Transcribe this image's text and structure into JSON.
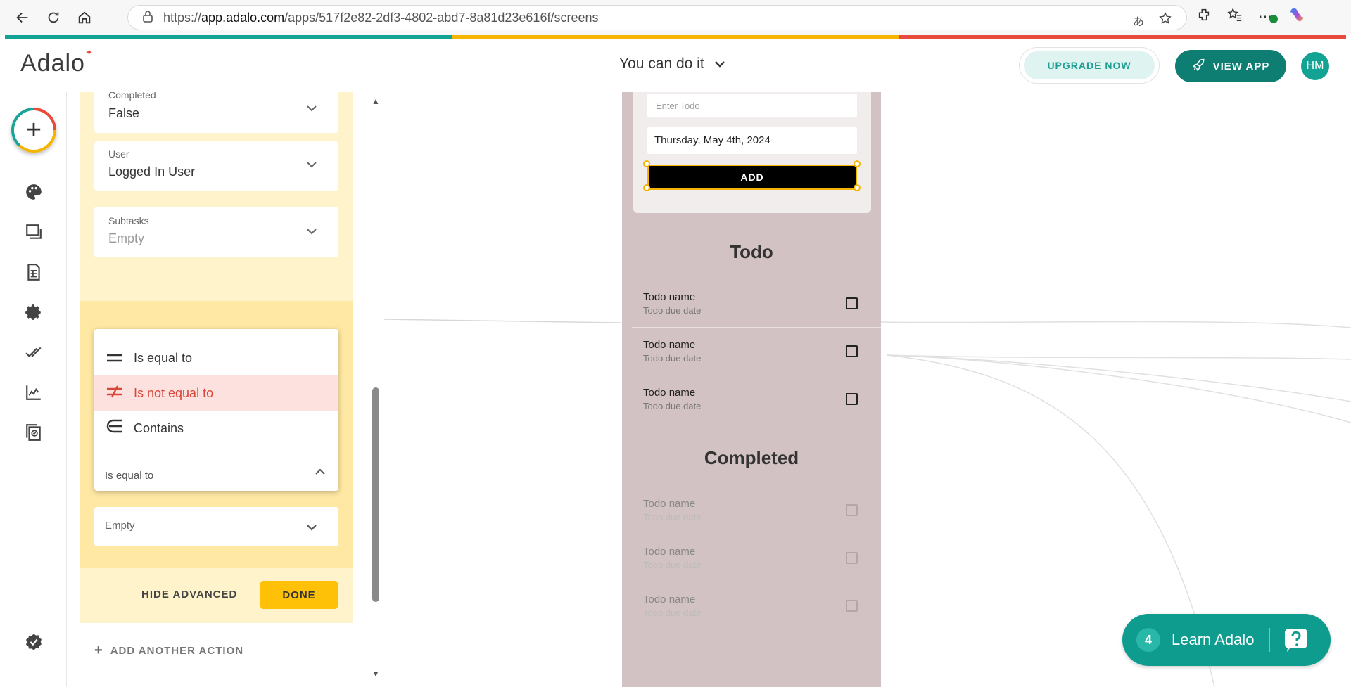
{
  "browser": {
    "url_prefix": "https://",
    "url_host": "app.adalo.com",
    "url_path": "/apps/517f2e82-2df3-4802-abd7-8a81d23e616f/screens",
    "read_aloud_glyph": "あ"
  },
  "colors": {
    "teal": "#13a394",
    "yellow": "#f4b400",
    "red": "#e84b3c",
    "phone_bg": "#d3c2c3",
    "panel_yellow": "#fff3cc",
    "panel_yellow_dark": "#ffe8a3"
  },
  "header": {
    "logo": "Adalo",
    "app_name": "You can do it",
    "upgrade_label": "UPGRADE NOW",
    "view_app_label": "VIEW APP",
    "avatar_initials": "HM"
  },
  "panel": {
    "fields": [
      {
        "label": "Completed",
        "value": "False",
        "muted": false
      },
      {
        "label": "User",
        "value": "Logged In User",
        "muted": false
      },
      {
        "label": "Subtasks",
        "value": "Empty",
        "muted": true
      }
    ],
    "dropdown": {
      "options": [
        {
          "icon": "equals-icon",
          "label": "Is equal to",
          "active": false
        },
        {
          "icon": "not-equal-icon",
          "label": "Is not equal to",
          "active": true
        },
        {
          "icon": "contains-icon",
          "label": "Contains",
          "active": false
        }
      ],
      "selected": "Is equal to"
    },
    "empty_select": "Empty",
    "hide_advanced": "HIDE ADVANCED",
    "done": "DONE",
    "add_action": "ADD ANOTHER ACTION"
  },
  "phone": {
    "todo_placeholder": "Enter Todo",
    "date_value": "Thursday, May 4th, 2024",
    "add_label": "ADD",
    "todo_title": "Todo",
    "completed_title": "Completed",
    "todo_items": [
      {
        "name": "Todo name",
        "date": "Todo due date"
      },
      {
        "name": "Todo name",
        "date": "Todo due date"
      },
      {
        "name": "Todo name",
        "date": "Todo due date"
      }
    ],
    "completed_items": [
      {
        "name": "Todo name",
        "date": "Todo due date"
      },
      {
        "name": "Todo name",
        "date": "Todo due date"
      },
      {
        "name": "Todo name",
        "date": "Todo due date"
      }
    ]
  },
  "learn": {
    "count": "4",
    "label": "Learn Adalo"
  }
}
